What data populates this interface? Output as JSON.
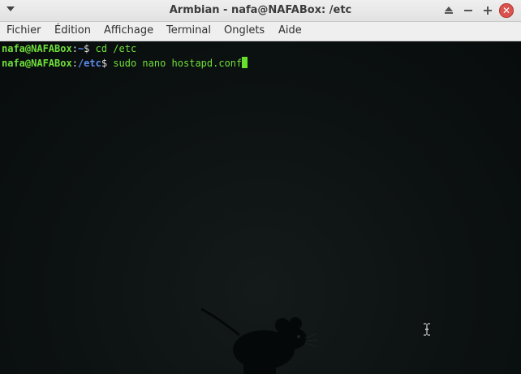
{
  "window": {
    "title": "Armbian - nafa@NAFABox: /etc",
    "menu_icon": "window-menu-icon",
    "buttons": [
      "shade-icon",
      "minimize-icon",
      "maximize-icon",
      "close-icon"
    ]
  },
  "menubar": {
    "items": [
      "Fichier",
      "Édition",
      "Affichage",
      "Terminal",
      "Onglets",
      "Aide"
    ]
  },
  "terminal": {
    "lines": [
      {
        "user_host": "nafa@NAFABox",
        "sep": ":",
        "path": "~",
        "prompt": "$ ",
        "command": "cd /etc"
      },
      {
        "user_host": "nafa@NAFABox",
        "sep": ":",
        "path": "/etc",
        "prompt": "$ ",
        "command": "sudo nano hostapd.conf"
      }
    ],
    "cursor_icon": "text-cursor-ibeam-icon",
    "background_logo": "xfce-mouse-logo"
  },
  "colors": {
    "prompt_user": "#6fe03a",
    "prompt_path": "#5c8cf0",
    "background": "#0d1212",
    "close_button": "#d9534f"
  }
}
